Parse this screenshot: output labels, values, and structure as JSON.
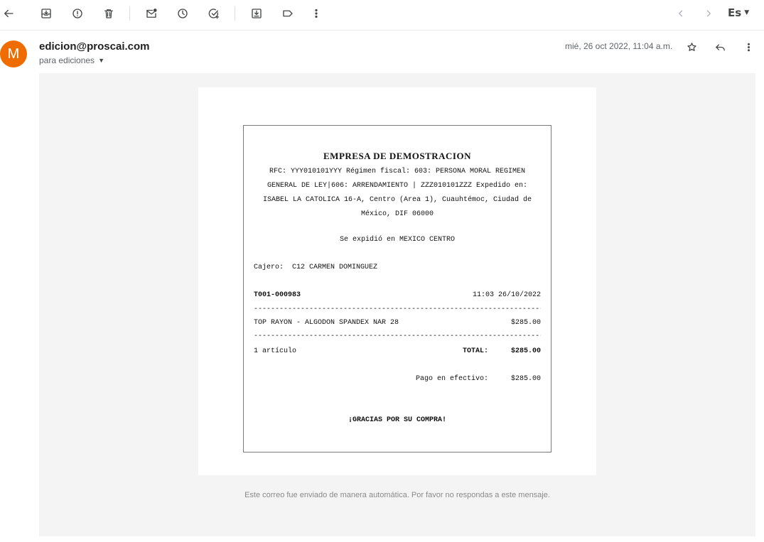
{
  "toolbar": {
    "icons": [
      "back-arrow-icon",
      "archive-icon",
      "report-spam-icon",
      "delete-icon",
      "mark-unread-icon",
      "snooze-icon",
      "add-task-icon",
      "move-to-icon",
      "label-icon",
      "more-vert-icon",
      "newer-icon",
      "older-icon"
    ],
    "language": "Es"
  },
  "message": {
    "avatar_letter": "M",
    "avatar_color": "#ef6c00",
    "sender": "edicion@proscai.com",
    "recipient": "para ediciones",
    "date": "mié, 26 oct 2022, 11:04 a.m."
  },
  "receipt": {
    "company": "EMPRESA DE DEMOSTRACION",
    "info": "RFC: YYY010101YYY   Régimen fiscal: 603: PERSONA MORAL REGIMEN GENERAL DE LEY|606: ARRENDAMIENTO   | ZZZ010101ZZZ   Expedido en: ISABEL LA CATOLICA 16-A, Centro (Area 1), Cuauhtémoc, Ciudad de México, DIF 06000",
    "issued_at": "Se expidió en MEXICO CENTRO",
    "cashier_label": "Cajero:",
    "cashier": "C12 CARMEN DOMINGUEZ",
    "ticket": "T001-000983",
    "datetime": "11:03 26/10/2022",
    "separator": "------------------------------------------------------------------------",
    "item_name": "TOP RAYON - ALGODON SPANDEX NAR 28",
    "item_price": "$285.00",
    "count": "1 artículo",
    "total_label": "TOTAL:",
    "total_value": "$285.00",
    "payment_label": "Pago en efectivo:",
    "payment_value": "$285.00",
    "thanks": "¡GRACIAS POR SU COMPRA!"
  },
  "footer": "Este correo fue enviado de manera automática. Por favor no respondas a este mensaje."
}
